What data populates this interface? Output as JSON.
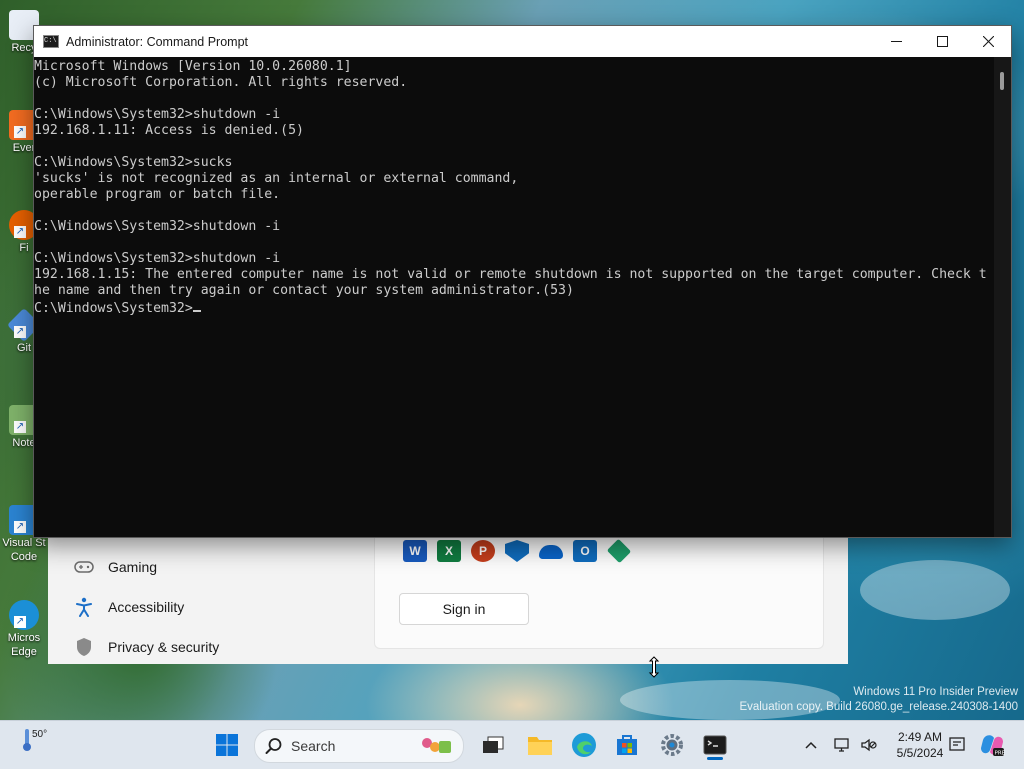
{
  "desktop": {
    "watermark_line1": "Windows 11 Pro Insider Preview",
    "watermark_line2": "Evaluation copy. Build 26080.ge_release.240308-1400",
    "icons": [
      {
        "label": "Recy",
        "color": "#e8eef6"
      },
      {
        "label": "Ever",
        "color": "#f36c21"
      },
      {
        "label": "Fi",
        "color": "#e66000"
      },
      {
        "label": "Git",
        "color": "#4b8ad8"
      },
      {
        "label": "Note",
        "color": "#7fb26a"
      },
      {
        "label": "Visual St",
        "label2": "Code",
        "color": "#2b84d2"
      },
      {
        "label": "Micros",
        "label2": "Edge",
        "color": "#1b8fd6"
      }
    ]
  },
  "settings_bg": {
    "items": [
      {
        "label": "Gaming",
        "icon": "gamepad-icon"
      },
      {
        "label": "Accessibility",
        "icon": "accessibility-icon"
      },
      {
        "label": "Privacy & security",
        "icon": "shield-icon"
      }
    ],
    "apps": [
      {
        "name": "word-icon",
        "glyph": "W",
        "color": "#185abd"
      },
      {
        "name": "excel-icon",
        "glyph": "X",
        "color": "#107c41"
      },
      {
        "name": "powerpoint-icon",
        "glyph": "P",
        "color": "#c43e1c"
      },
      {
        "name": "defender-icon",
        "glyph": "",
        "color": "#0f6cbd"
      },
      {
        "name": "onedrive-icon",
        "glyph": "",
        "color": "#0a64c8"
      },
      {
        "name": "outlook-icon",
        "glyph": "O",
        "color": "#0f6cbd"
      },
      {
        "name": "family-icon",
        "glyph": "",
        "color": "#1e9e6a"
      }
    ],
    "sign_in_label": "Sign in"
  },
  "cmd": {
    "title": "Administrator: Command Prompt",
    "lines": [
      "Microsoft Windows [Version 10.0.26080.1]",
      "(c) Microsoft Corporation. All rights reserved.",
      "",
      "C:\\Windows\\System32>shutdown -i",
      "192.168.1.11: Access is denied.(5)",
      "",
      "C:\\Windows\\System32>sucks",
      "'sucks' is not recognized as an internal or external command,",
      "operable program or batch file.",
      "",
      "C:\\Windows\\System32>shutdown -i",
      "",
      "C:\\Windows\\System32>shutdown -i",
      "192.168.1.15: The entered computer name is not valid or remote shutdown is not supported on the target computer. Check t",
      "he name and then try again or contact your system administrator.(53)",
      ""
    ],
    "prompt": "C:\\Windows\\System32>"
  },
  "taskbar": {
    "temperature": "50°",
    "search_label": "Search",
    "time": "2:49 AM",
    "date": "5/5/2024"
  }
}
